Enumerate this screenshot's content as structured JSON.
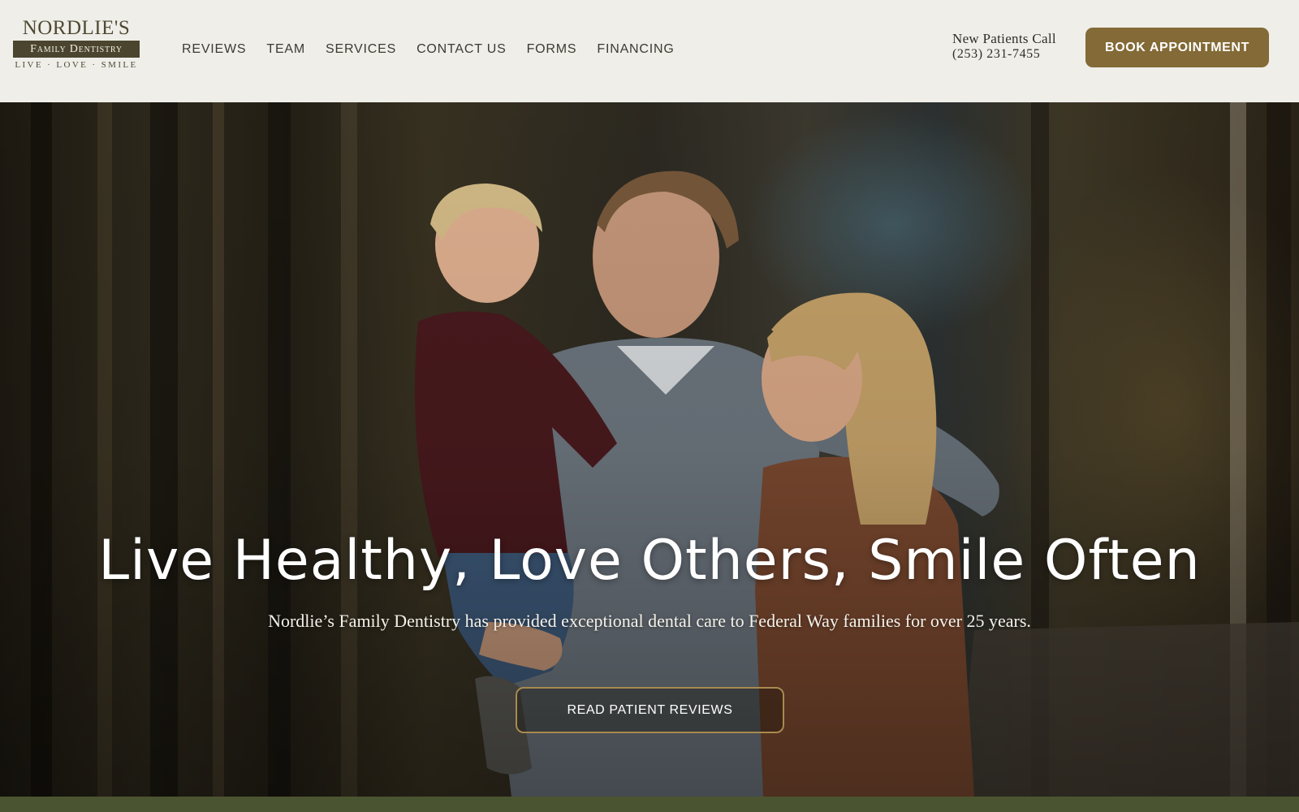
{
  "brand": {
    "name": "NORDLIE'S",
    "subtitle": "Family Dentistry",
    "tagline": "LIVE · LOVE · SMILE",
    "color_primary": "#4b4530",
    "color_accent": "#836a36"
  },
  "nav": {
    "items": [
      {
        "label": "REVIEWS"
      },
      {
        "label": "TEAM"
      },
      {
        "label": "SERVICES"
      },
      {
        "label": "CONTACT US"
      },
      {
        "label": "FORMS"
      },
      {
        "label": "FINANCING"
      }
    ]
  },
  "contact": {
    "label": "New Patients Call",
    "phone": "(253) 231-7455"
  },
  "cta": {
    "book_label": "BOOK APPOINTMENT"
  },
  "hero": {
    "title": "Live Healthy, Love Others, Smile Often",
    "subtitle": "Nordlie’s Family Dentistry has provided exceptional dental care to Federal Way families for over 25 years.",
    "button_label": "READ PATIENT REVIEWS"
  }
}
